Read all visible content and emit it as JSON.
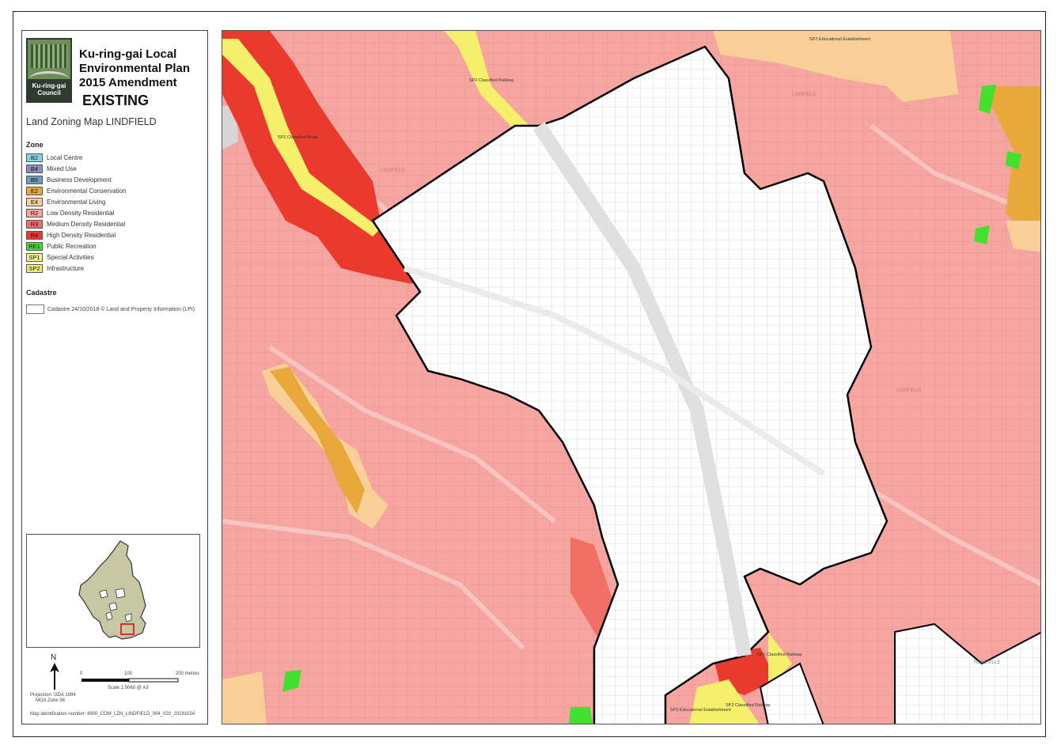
{
  "header": {
    "council_name": "Ku-ring-gai Council",
    "title_line1": "Ku-ring-gai Local",
    "title_line2": "Environmental Plan",
    "title_line3": "2015 Amendment",
    "status": "EXISTING",
    "map_title": "Land Zoning Map LINDFIELD"
  },
  "legend": {
    "zone_heading": "Zone",
    "zones": [
      {
        "code": "B2",
        "label": "Local Centre",
        "color": "#7fd8e6"
      },
      {
        "code": "B4",
        "label": "Mixed Use",
        "color": "#8a8fbf"
      },
      {
        "code": "B5",
        "label": "Business Development",
        "color": "#6f9fb5"
      },
      {
        "code": "E2",
        "label": "Environmental Conservation",
        "color": "#e8a83a"
      },
      {
        "code": "E4",
        "label": "Environmental Living",
        "color": "#f8cf96"
      },
      {
        "code": "R2",
        "label": "Low Density Residential",
        "color": "#f6a5a0"
      },
      {
        "code": "R3",
        "label": "Medium Density Residential",
        "color": "#f26f66"
      },
      {
        "code": "R4",
        "label": "High Density Residential",
        "color": "#ea3a2e"
      },
      {
        "code": "RE1",
        "label": "Public Recreation",
        "color": "#44e030"
      },
      {
        "code": "SP1",
        "label": "Special Activities",
        "color": "#f4f28a"
      },
      {
        "code": "SP2",
        "label": "Infrastructure",
        "color": "#f5f06a"
      }
    ],
    "cadastre_heading": "Cadastre",
    "cadastre_label": "Cadastre 24/10/2018 © Land and Property Information (LPI)"
  },
  "scale": {
    "north": "N",
    "tick_0": "0",
    "tick_100": "100",
    "tick_200": "200 metres",
    "scale_text": "Scale  1:5060   @ A3",
    "projection_line1": "Projection: GDA 1994",
    "projection_line2": "MGA Zone 56",
    "map_id": "Map identification number:   4900_COM_LZN_LINDFIELD_004_020_20181024"
  },
  "map_labels": {
    "sp2_railway_top": "SP2 Classified Railway",
    "sp2_road": "SP2 Classified Road",
    "sp2_edu_top": "SP2 Educational Establishment",
    "lindfield_ne": "LINDFIELD",
    "lindfield_w": "LINDFIELD",
    "lindfield_e": "LINDFIELD",
    "roseville": "ROSEVILLE",
    "sp2_railway_bottom": "SP2 Classified Railway",
    "sp2_edu_bottom": "SP2 Educational Establishment",
    "sp2_railway_bottom2": "SP2 Classified Railway"
  }
}
